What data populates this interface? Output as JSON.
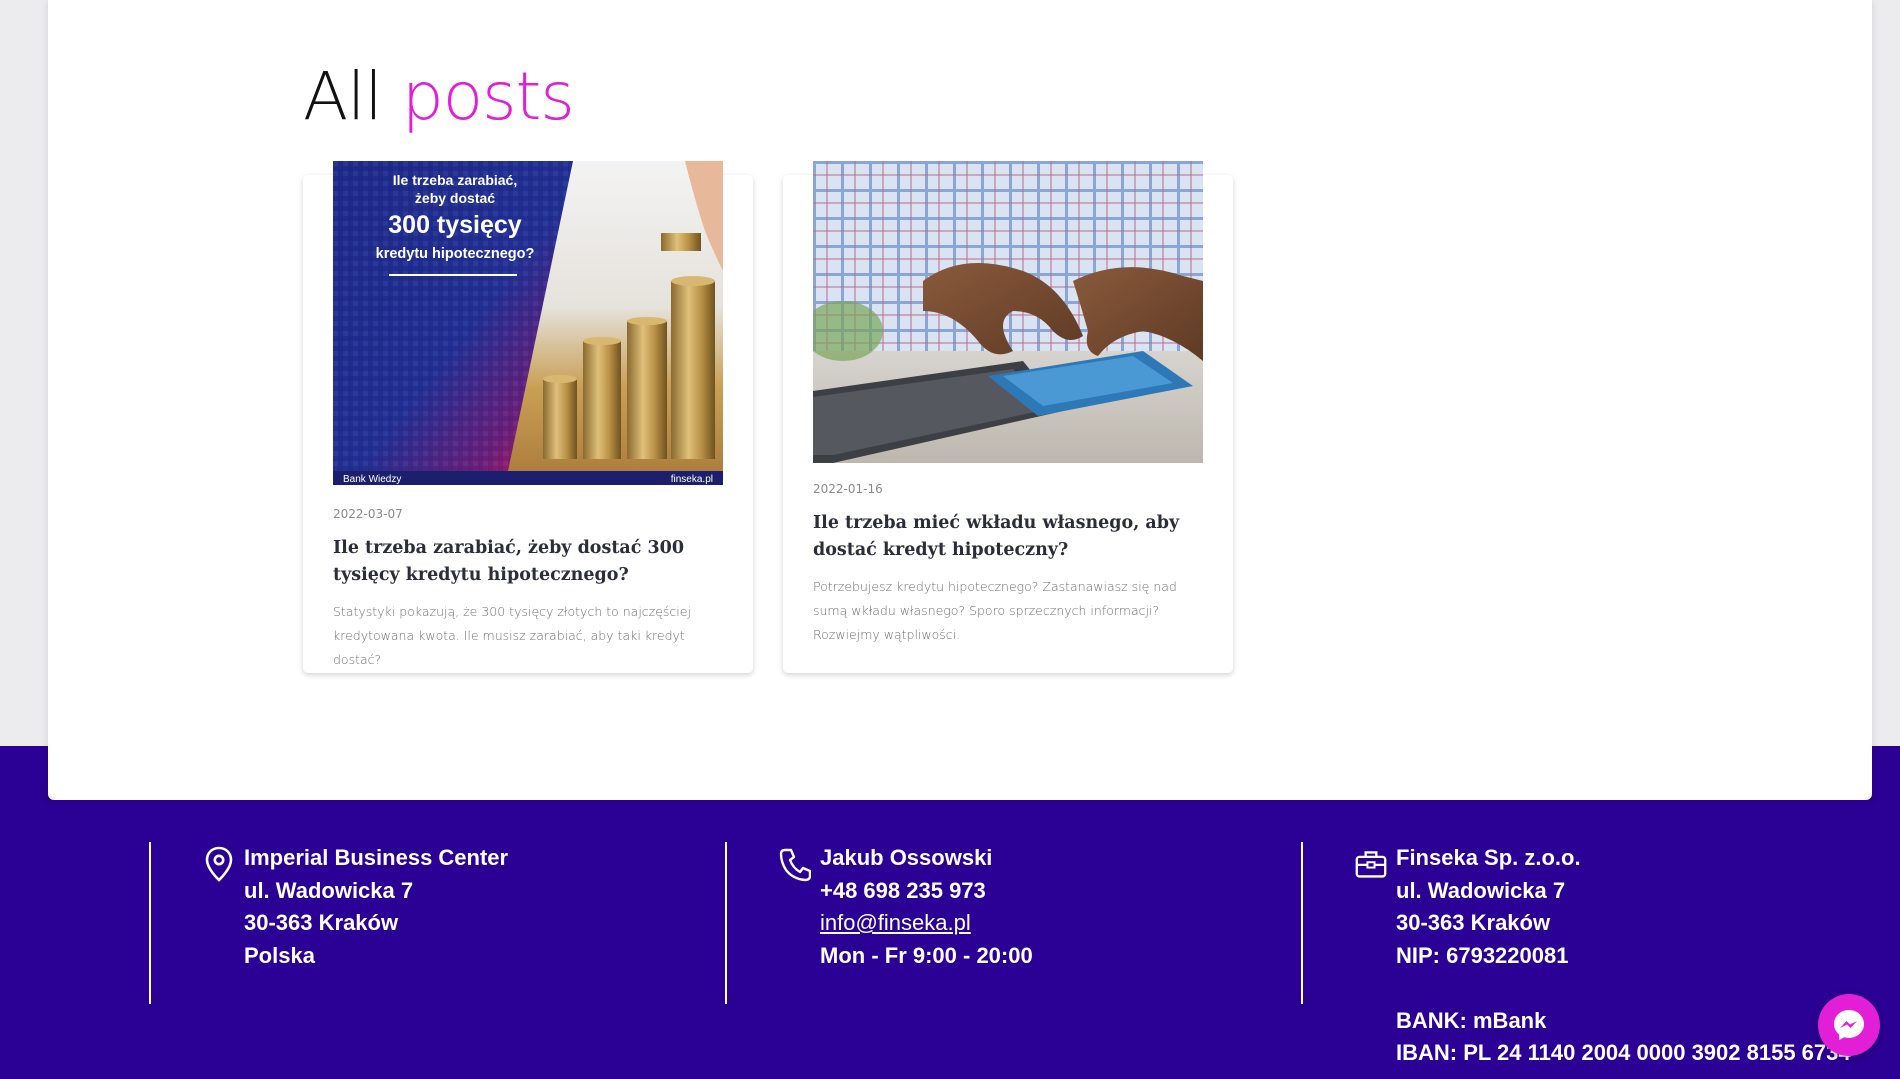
{
  "page": {
    "title_main": "All",
    "title_accent": "posts",
    "accent_color": "#e21fd7",
    "footer_color": "#2b0094"
  },
  "posts": [
    {
      "image_text": {
        "line1": "Ile trzeba zarabiać,",
        "line2": "żeby dostać",
        "line3": "300 tysięcy",
        "line4": "kredytu hipotecznego?",
        "footer_left": "Bank Wiedzy",
        "footer_right": "finseka.pl"
      },
      "date": "2022-03-07",
      "title": "Ile trzeba zarabiać, żeby dostać 300 tysięcy kredytu hipotecznego?",
      "excerpt": "Statystyki pokazują, że 300 tysięcy złotych to najczęściej kredytowana kwota. Ile musisz zarabiać, aby taki kredyt dostać?"
    },
    {
      "date": "2022-01-16",
      "title": "Ile trzeba mieć wkładu własnego, aby dostać kredyt hipoteczny?",
      "excerpt": "Potrzebujesz kredytu hipotecznego? Zastanawiasz się nad sumą wkładu własnego? Sporo sprzecznych informacji? Rozwiejmy wątpliwości."
    }
  ],
  "footer": {
    "address": {
      "icon": "location-pin-icon",
      "line1": "Imperial Business Center",
      "line2": "ul. Wadowicka 7",
      "line3": "30-363 Kraków",
      "line4": "Polska"
    },
    "contact": {
      "icon": "phone-icon",
      "name": "Jakub Ossowski",
      "phone": "+48 698 235 973",
      "email": "info@finseka.pl",
      "hours": "Mon - Fr 9:00 - 20:00"
    },
    "company": {
      "icon": "briefcase-icon",
      "name": "Finseka Sp. z.o.o.",
      "street": "ul. Wadowicka 7",
      "city": "30-363 Kraków",
      "nip": "NIP: 6793220081",
      "bank": "BANK: mBank",
      "iban": "IBAN: PL 24 1140 2004 0000 3902 8155 6734"
    }
  },
  "messenger": {
    "icon": "messenger-icon"
  }
}
